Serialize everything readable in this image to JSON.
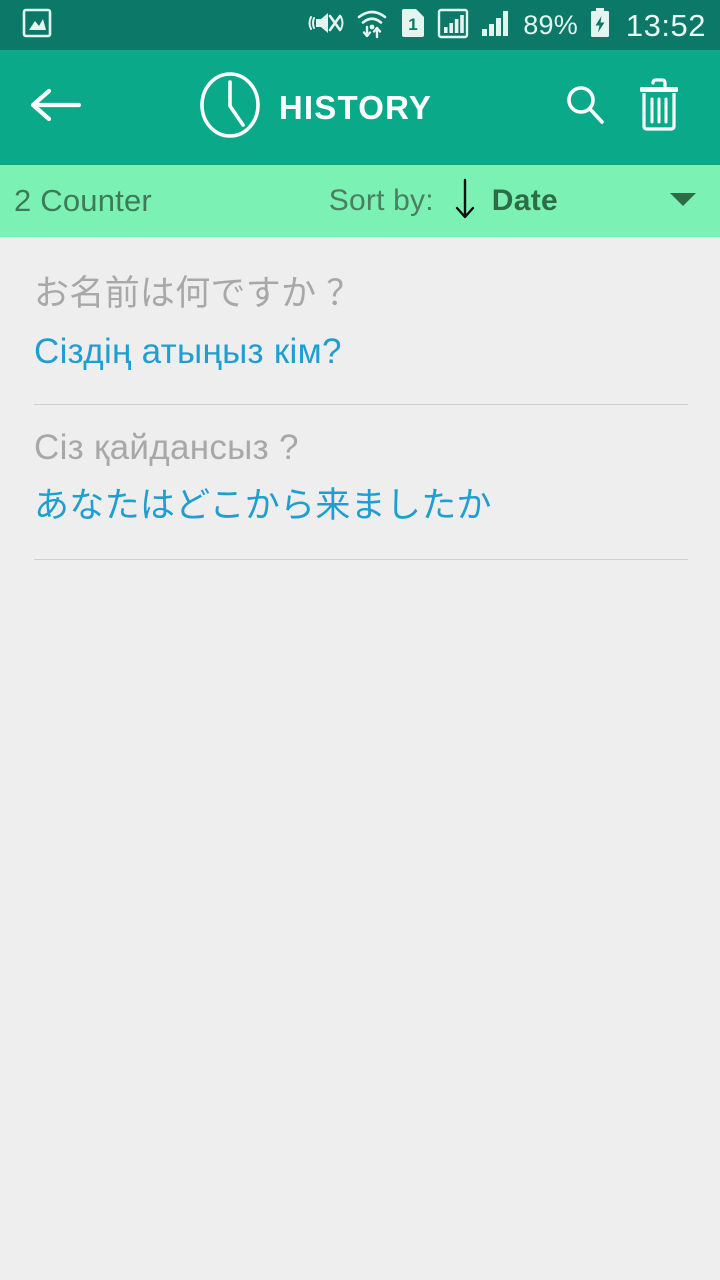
{
  "status_bar": {
    "icons": [
      "image-photo-icon",
      "vibrate-mute-icon",
      "wifi-transfer-icon",
      "sim-one-icon",
      "signal-boxed-icon",
      "signal-bars-icon"
    ],
    "sim_badge": "1",
    "battery_percent": "89%",
    "battery_icon": "battery-charging-icon",
    "time": "13:52",
    "background_color": "#0c7868",
    "foreground_color": "#e4f5f0"
  },
  "action_bar": {
    "back_icon": "back-arrow-icon",
    "title_icon": "clock-icon",
    "title": "HISTORY",
    "search_icon": "search-icon",
    "delete_icon": "trash-icon",
    "background_color": "#0aa98a",
    "foreground_color": "#ffffff"
  },
  "sort_bar": {
    "counter": "2 Counter",
    "sort_by_label": "Sort by:",
    "sort_direction_icon": "arrow-down-icon",
    "sort_value": "Date",
    "dropdown_icon": "caret-down-icon",
    "background_color": "#7bf2b4"
  },
  "history": {
    "items": [
      {
        "source": "お名前は何ですか ？",
        "target": "Сіздің атыңыз кім?"
      },
      {
        "source": "Сіз қайдансыз ?",
        "target": "あなたはどこから来ましたか"
      }
    ],
    "source_color": "#a8a8a8",
    "target_color": "#1f9ed0",
    "background_color": "#eeeeee"
  }
}
